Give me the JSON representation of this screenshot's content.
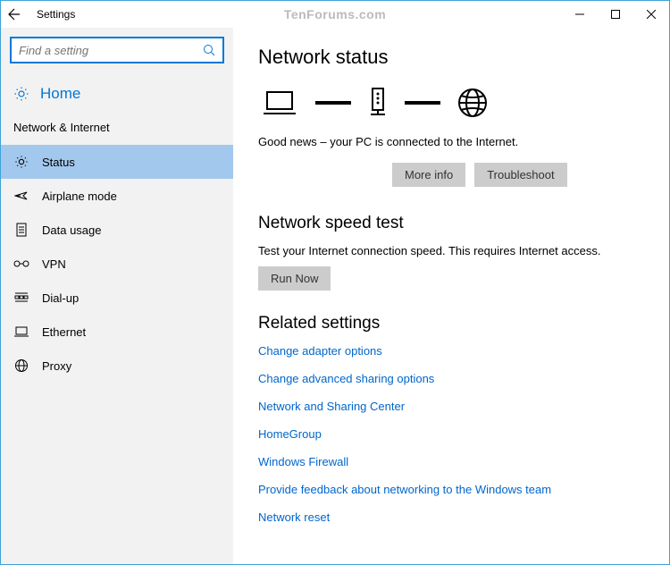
{
  "titlebar": {
    "title": "Settings"
  },
  "watermark": "TenForums.com",
  "sidebar": {
    "search_placeholder": "Find a setting",
    "home_label": "Home",
    "section_label": "Network & Internet",
    "items": [
      {
        "label": "Status",
        "selected": true
      },
      {
        "label": "Airplane mode"
      },
      {
        "label": "Data usage"
      },
      {
        "label": "VPN"
      },
      {
        "label": "Dial-up"
      },
      {
        "label": "Ethernet"
      },
      {
        "label": "Proxy"
      }
    ]
  },
  "main": {
    "status_heading": "Network status",
    "status_text": "Good news – your PC is connected to the Internet.",
    "more_info_label": "More info",
    "troubleshoot_label": "Troubleshoot",
    "speed_heading": "Network speed test",
    "speed_desc": "Test your Internet connection speed. This requires Internet access.",
    "run_now_label": "Run Now",
    "related_heading": "Related settings",
    "links": [
      "Change adapter options",
      "Change advanced sharing options",
      "Network and Sharing Center",
      "HomeGroup",
      "Windows Firewall",
      "Provide feedback about networking to the Windows team",
      "Network reset"
    ]
  }
}
